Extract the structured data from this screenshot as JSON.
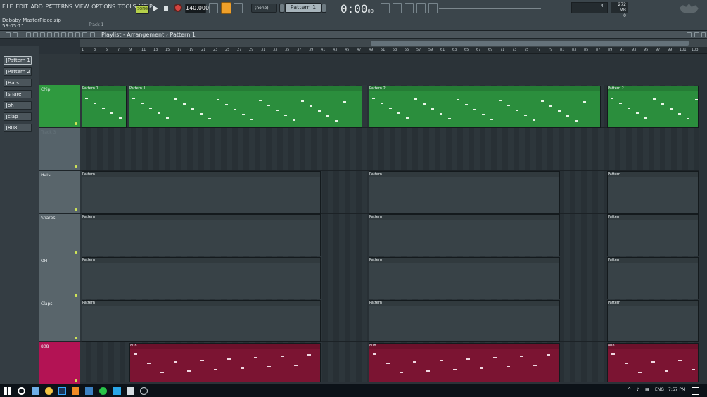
{
  "menu": [
    "FILE",
    "EDIT",
    "ADD",
    "PATTERNS",
    "VIEW",
    "OPTIONS",
    "TOOLS",
    "HELP"
  ],
  "project": {
    "file": "Dababy MasterPiece.zip",
    "time": "53:05:11",
    "track": "Track 1"
  },
  "transport": {
    "mode": "SONG",
    "tempo": "140.000",
    "snap": "(none)",
    "pattern": "Pattern 1",
    "clock": "0:00",
    "clock_small": "00"
  },
  "memory": {
    "cpu": "4",
    "ram": "272 MB",
    "polyphony": "0"
  },
  "playlist": {
    "breadcrumb": "Playlist - Arrangement › Pattern 1"
  },
  "patterns": [
    {
      "label": "Pattern 1",
      "active": true
    },
    {
      "label": "Pattern 2",
      "active": false
    },
    {
      "label": "Hats",
      "active": false
    },
    {
      "label": "snare",
      "active": false
    },
    {
      "label": "oh",
      "active": false
    },
    {
      "label": "clap",
      "active": false
    },
    {
      "label": "808",
      "active": false
    }
  ],
  "tracks": [
    "Chip",
    "Track 3",
    "Hats",
    "Snares",
    "OH",
    "Claps",
    "808"
  ],
  "ruler": [
    "1",
    "3",
    "5",
    "7",
    "9",
    "11",
    "13",
    "15",
    "17",
    "19",
    "21",
    "23",
    "25",
    "27",
    "29",
    "31",
    "33",
    "35",
    "37",
    "39",
    "41",
    "43",
    "45",
    "47",
    "49",
    "51",
    "53",
    "55",
    "57",
    "59",
    "61",
    "63",
    "65",
    "67",
    "69",
    "71",
    "73",
    "75",
    "77",
    "79",
    "81",
    "83",
    "85",
    "87",
    "89",
    "91",
    "93",
    "95",
    "97",
    "99",
    "101",
    "103"
  ],
  "clips": {
    "chip_left": "Pattern 1",
    "chip_mid": "Pattern 2",
    "chip_right": "Pattern 2",
    "drum_label": "Pattern",
    "bass_label": "808"
  },
  "system": {
    "language": "ENG",
    "clock": "7:57 PM"
  },
  "colors": {
    "green": "#2b8e3d",
    "crimson": "#7b1432",
    "accent": "#f0a029"
  }
}
